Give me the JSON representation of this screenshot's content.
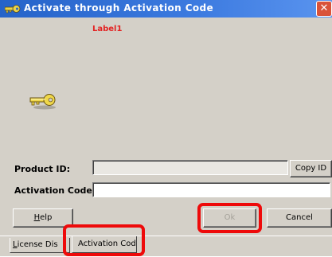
{
  "window": {
    "title": "Activate through Activation Code",
    "close_glyph": "✕"
  },
  "content": {
    "label1": "Label1",
    "key_icon": "key-icon"
  },
  "form": {
    "product_id_label": "Product ID:",
    "product_id_value": "",
    "activation_code_label": "Activation Code:",
    "activation_code_value": ""
  },
  "buttons": {
    "copy_id": "Copy ID",
    "help_prefix": "",
    "help_underlined": "H",
    "help_rest": "elp",
    "ok": "Ok",
    "cancel": "Cancel"
  },
  "tabs": {
    "license_underlined": "L",
    "license_rest": "icense Dis",
    "activation_code": "Activation Code"
  },
  "colors": {
    "highlight": "#ee0a0a",
    "label_red": "#e32222",
    "titlebar_blue": "#2563c9"
  }
}
